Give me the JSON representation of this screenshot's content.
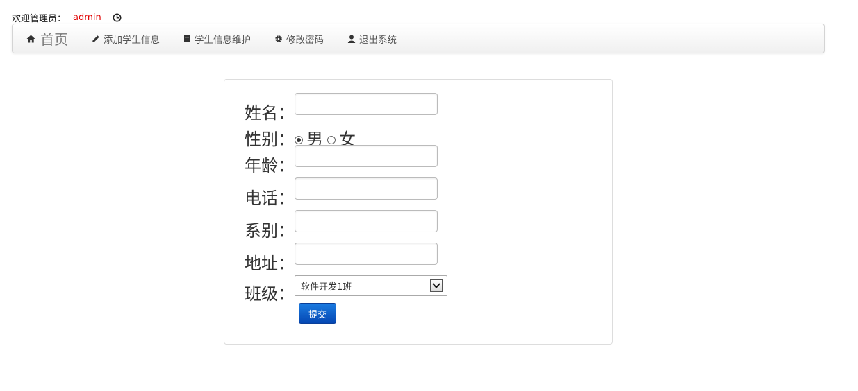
{
  "welcome": {
    "prefix": "欢迎管理员：",
    "username": "admin"
  },
  "navbar": {
    "brand": "首页",
    "items": [
      {
        "label": "添加学生信息",
        "icon": "pencil-icon"
      },
      {
        "label": "学生信息维护",
        "icon": "book-icon"
      },
      {
        "label": "修改密码",
        "icon": "gear-icon"
      },
      {
        "label": "退出系统",
        "icon": "user-icon"
      }
    ]
  },
  "form": {
    "name_label": "姓名：",
    "gender_label": "性别：",
    "gender_options": [
      "男",
      "女"
    ],
    "gender_selected": "男",
    "age_label": "年龄：",
    "phone_label": "电话：",
    "department_label": "系别：",
    "address_label": "地址：",
    "class_label": "班级：",
    "class_selected": "软件开发1班",
    "submit_label": "提交"
  },
  "colors": {
    "username": "#e00000",
    "button": "#0a5fc8"
  }
}
